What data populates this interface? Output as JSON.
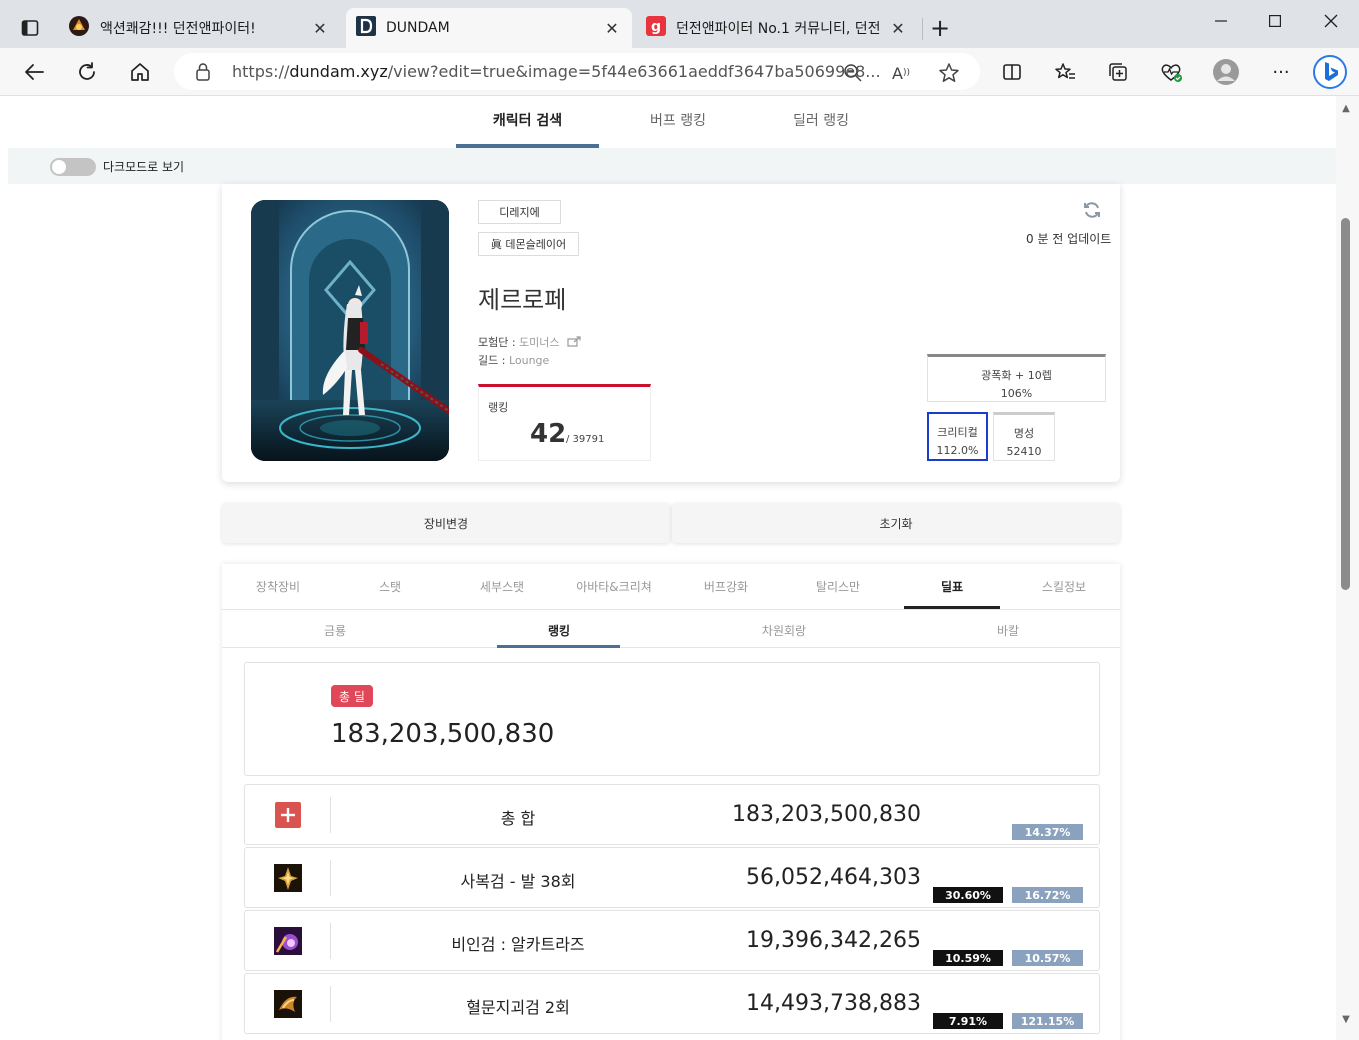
{
  "browser": {
    "tabs": [
      {
        "title": "액션쾌감!!! 던전앤파이터!",
        "active": false
      },
      {
        "title": "DUNDAM",
        "active": true
      },
      {
        "title": "던전앤파이터 No.1 커뮤니티, 던전",
        "active": false
      }
    ],
    "url_prefix": "https://",
    "url_host": "dundam.xyz",
    "url_path": "/view?edit=true&image=5f44e63661aeddf3647ba50699e8..."
  },
  "nav": {
    "items": [
      "캐릭터 검색",
      "버프 랭킹",
      "딜러 랭킹"
    ],
    "active_index": 0
  },
  "dark_mode": {
    "label": "다크모드로 보기",
    "enabled": false
  },
  "character": {
    "server": "디레지에",
    "job": "眞 데몬슬레이어",
    "name": "제르로페",
    "adventure_label": "모험단 : ",
    "adventure": "도미너스",
    "guild_label": "길드 : ",
    "guild": "Lounge",
    "rank_label": "랭킹",
    "rank": "42",
    "rank_total": "/ 39791",
    "update_text": "0 분 전 업데이트",
    "stats": {
      "buff_label": "광폭화 + 10렙",
      "buff_value": "106%",
      "crit_label": "크리티컬",
      "crit_value": "112.0%",
      "fame_label": "명성",
      "fame_value": "52410"
    }
  },
  "actions": {
    "change_equipment": "장비변경",
    "reset": "초기화"
  },
  "tabs": {
    "items": [
      "장착장비",
      "스탯",
      "세부스탯",
      "아바타&크리쳐",
      "버프강화",
      "탈리스만",
      "딜표",
      "스킬정보"
    ],
    "active_index": 6
  },
  "subtabs": {
    "items": [
      "금룡",
      "랭킹",
      "차원회랑",
      "바칼"
    ],
    "active_index": 1
  },
  "total": {
    "badge": "총 딜",
    "value": "183,203,500,830"
  },
  "colors": {
    "accent": "#4c6f94",
    "rank_red": "#c8102e",
    "badge_red": "#e04758",
    "pct_blue": "#8ba2be",
    "crit_border": "#1a3ccf"
  },
  "rows": [
    {
      "icon": "plus-icon",
      "name": "총 합",
      "value": "183,203,500,830",
      "pct1": "",
      "pct2": "14.37%"
    },
    {
      "icon": "skill-icon-sabokgeom",
      "name": "사복검 - 발 38회",
      "value": "56,052,464,303",
      "pct1": "30.60%",
      "pct2": "16.72%"
    },
    {
      "icon": "skill-icon-biingeom",
      "name": "비인검 : 알카트라즈",
      "value": "19,396,342,265",
      "pct1": "10.59%",
      "pct2": "10.57%"
    },
    {
      "icon": "skill-icon-hyeolmun",
      "name": "혈문지괴검 2회",
      "value": "14,493,738,883",
      "pct1": "7.91%",
      "pct2": "121.15%"
    }
  ]
}
